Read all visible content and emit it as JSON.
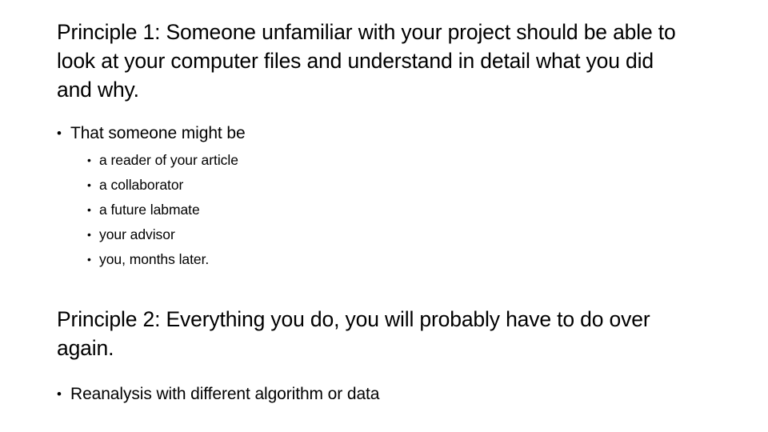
{
  "slide": {
    "background_color": "#ffffff",
    "text_color": "#000000",
    "bullet_glyph": "•",
    "blocks": {
      "principle_1_heading": "Principle 1: Someone unfamiliar with your project should be able to look at your computer files and understand in detail what you did and why.",
      "principle_1_bullet": "That someone might be",
      "principle_1_sub_bullets": [
        "a reader of your article",
        "a collaborator",
        "a future labmate",
        "your advisor",
        "you, months later."
      ],
      "principle_2_heading": "Principle 2: Everything you do, you will probably have to do over again.",
      "principle_2_bullet": "Reanalysis with different algorithm or data"
    }
  }
}
